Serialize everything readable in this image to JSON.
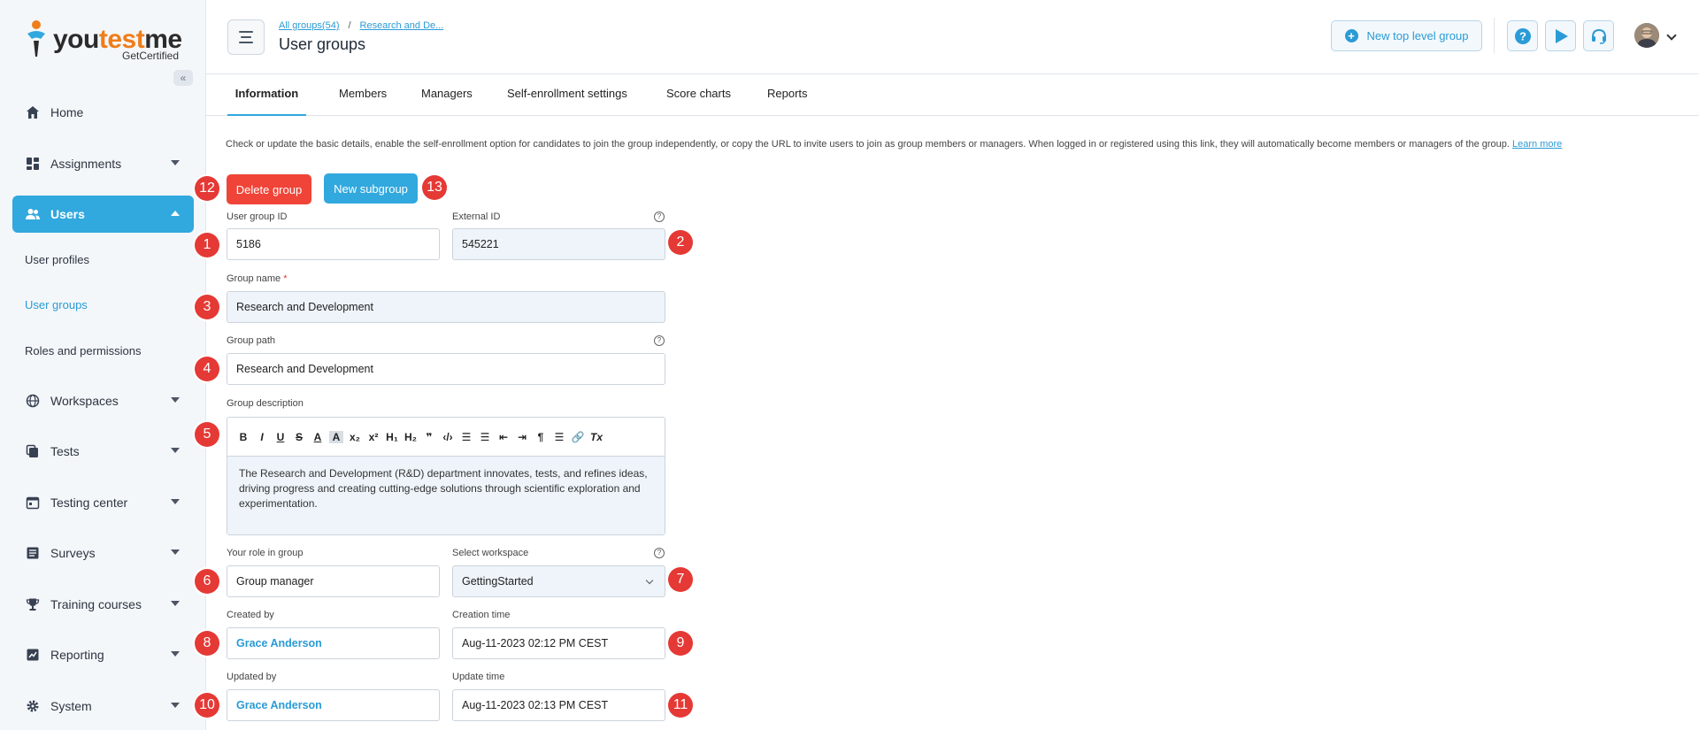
{
  "brand": {
    "name_part1": "you",
    "name_part2": "test",
    "name_part3": "me",
    "tagline": "GetCertified",
    "accent_color": "#ef7d1a",
    "primary_color": "#31a8de"
  },
  "sidebar": {
    "collapse_icon": "double-chevron-left-icon",
    "items": [
      {
        "label": "Home",
        "icon": "home-icon"
      },
      {
        "label": "Assignments",
        "icon": "dashboard-icon"
      },
      {
        "label": "Users",
        "icon": "users-icon"
      },
      {
        "label": "Workspaces",
        "icon": "globe-icon"
      },
      {
        "label": "Tests",
        "icon": "copy-icon"
      },
      {
        "label": "Testing center",
        "icon": "calendar-icon"
      },
      {
        "label": "Surveys",
        "icon": "list-icon"
      },
      {
        "label": "Training courses",
        "icon": "trophy-icon"
      },
      {
        "label": "Reporting",
        "icon": "report-icon"
      },
      {
        "label": "System",
        "icon": "gear-icon"
      }
    ],
    "users_sub": [
      {
        "label": "User profiles"
      },
      {
        "label": "User groups"
      },
      {
        "label": "Roles and permissions"
      }
    ]
  },
  "header": {
    "breadcrumb_root": "All groups(54)",
    "breadcrumb_sep": "/",
    "breadcrumb_current": "Research and De...",
    "title": "User groups",
    "new_top_group": "New top level group"
  },
  "tabs": [
    {
      "label": "Information"
    },
    {
      "label": "Members"
    },
    {
      "label": "Managers"
    },
    {
      "label": "Self-enrollment settings"
    },
    {
      "label": "Score charts"
    },
    {
      "label": "Reports"
    }
  ],
  "info": {
    "text": "Check or update the basic details, enable the self-enrollment option for candidates to join the group independently, or copy the URL to invite users to join as group members or managers. When logged in or registered using this link, they will automatically become members or managers of the group.",
    "learn_more": "Learn more"
  },
  "actions": {
    "delete_group": "Delete group",
    "new_subgroup": "New subgroup"
  },
  "form": {
    "user_group_id_label": "User group ID",
    "user_group_id": "5186",
    "external_id_label": "External ID",
    "external_id": "545221",
    "group_name_label": "Group name",
    "required_mark": "*",
    "group_name": "Research and Development",
    "group_path_label": "Group path",
    "group_path": "Research and Development",
    "group_description_label": "Group description",
    "group_description": "The Research and Development (R&D) department innovates, tests, and refines ideas, driving progress and creating cutting-edge solutions through scientific exploration and experimentation.",
    "role_label": "Your role in group",
    "role": "Group manager",
    "workspace_label": "Select workspace",
    "workspace": "GettingStarted",
    "created_by_label": "Created by",
    "created_by": "Grace Anderson",
    "creation_time_label": "Creation time",
    "creation_time": "Aug-11-2023 02:12 PM CEST",
    "updated_by_label": "Updated by",
    "updated_by": "Grace Anderson",
    "update_time_label": "Update time",
    "update_time": "Aug-11-2023 02:13 PM CEST"
  },
  "toolbar": [
    "B",
    "I",
    "U",
    "S",
    "A",
    "A",
    "x₂",
    "x²",
    "H₁",
    "H₂",
    "❞",
    "‹/›",
    "☰",
    "☰",
    "⇤",
    "⇥",
    "¶",
    "☰",
    "🔗",
    "Tx"
  ],
  "badges": [
    "1",
    "2",
    "3",
    "4",
    "5",
    "6",
    "7",
    "8",
    "9",
    "10",
    "11",
    "12",
    "13"
  ]
}
